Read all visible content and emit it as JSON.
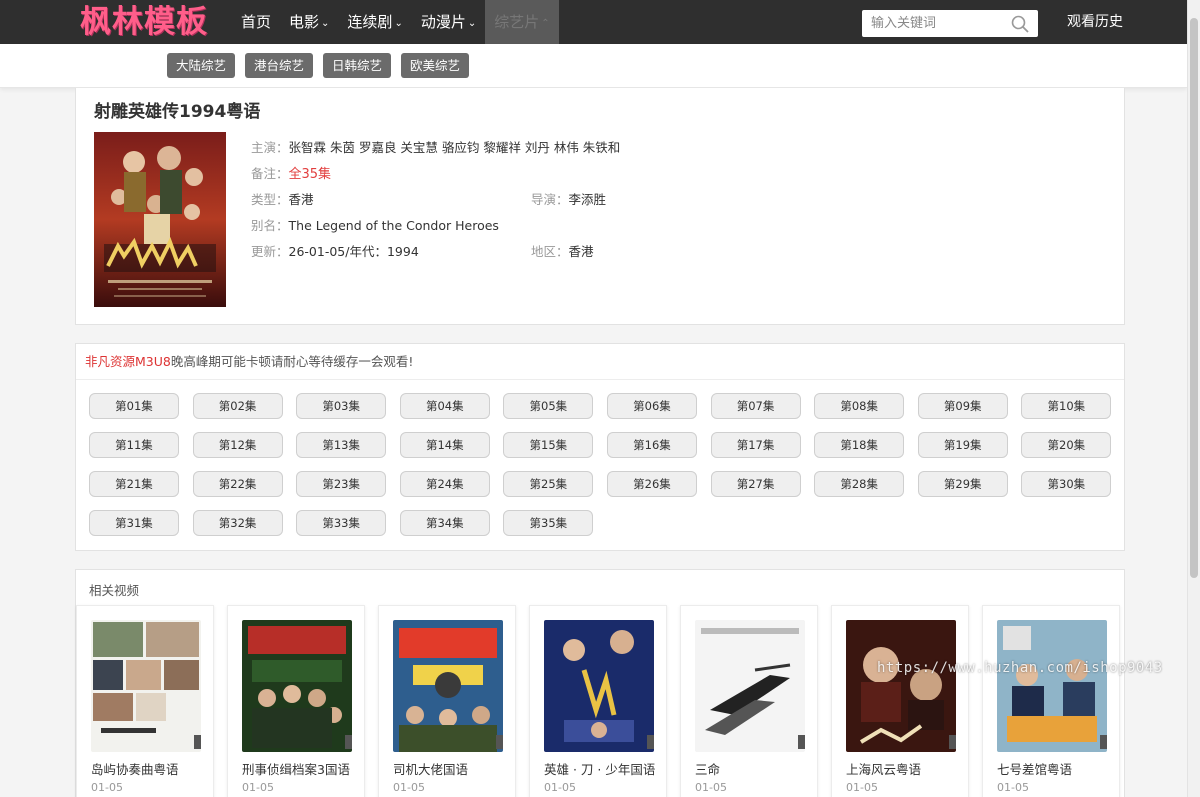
{
  "header": {
    "logo": "枫林模板",
    "nav": [
      {
        "label": "首页",
        "caret": ""
      },
      {
        "label": "电影",
        "caret": "⌄"
      },
      {
        "label": "连续剧",
        "caret": "⌄"
      },
      {
        "label": "动漫片",
        "caret": "⌄"
      },
      {
        "label": "综艺片",
        "caret": "⌃"
      }
    ],
    "search_placeholder": "输入关键词",
    "history": "观看历史"
  },
  "subnav": [
    "大陆综艺",
    "港台综艺",
    "日韩综艺",
    "欧美综艺"
  ],
  "detail": {
    "title": "射雕英雄传1994粤语",
    "cast_label": "主演：",
    "cast": "张智霖 朱茵 罗嘉良 关宝慧 骆应钧 黎耀祥 刘丹 林伟 朱铁和",
    "note_label": "备注：",
    "note": "全35集",
    "type_label": "类型：",
    "type": "香港",
    "director_label": "导演：",
    "director": "李添胜",
    "alias_label": "别名：",
    "alias": "The Legend of the Condor Heroes",
    "update_label": "更新：",
    "update": "26-01-05/年代：1994",
    "region_label": "地区：",
    "region": "香港"
  },
  "playlist": {
    "source": "非凡资源M3U8",
    "notice": "晚高峰期可能卡顿请耐心等待缓存一会观看!",
    "episodes": [
      "第01集",
      "第02集",
      "第03集",
      "第04集",
      "第05集",
      "第06集",
      "第07集",
      "第08集",
      "第09集",
      "第10集",
      "第11集",
      "第12集",
      "第13集",
      "第14集",
      "第15集",
      "第16集",
      "第17集",
      "第18集",
      "第19集",
      "第20集",
      "第21集",
      "第22集",
      "第23集",
      "第24集",
      "第25集",
      "第26集",
      "第27集",
      "第28集",
      "第29集",
      "第30集",
      "第31集",
      "第32集",
      "第33集",
      "第34集",
      "第35集"
    ]
  },
  "related": {
    "heading": "相关视频",
    "items": [
      {
        "title": "岛屿协奏曲粤语",
        "date": "01-05"
      },
      {
        "title": "刑事侦缉档案3国语",
        "date": "01-05"
      },
      {
        "title": "司机大佬国语",
        "date": "01-05"
      },
      {
        "title": "英雄 · 刀 · 少年国语",
        "date": "01-05"
      },
      {
        "title": "三命",
        "date": "01-05"
      },
      {
        "title": "上海风云粤语",
        "date": "01-05"
      },
      {
        "title": "七号差馆粤语",
        "date": "01-05"
      }
    ]
  },
  "watermark": "https://www.huzhan.com/ishop9043",
  "colors": {
    "topbar": "#2f2f2f",
    "logo": "#ff5e8a",
    "accent_red": "#e23e3e",
    "chip": "#6b6b6b"
  }
}
